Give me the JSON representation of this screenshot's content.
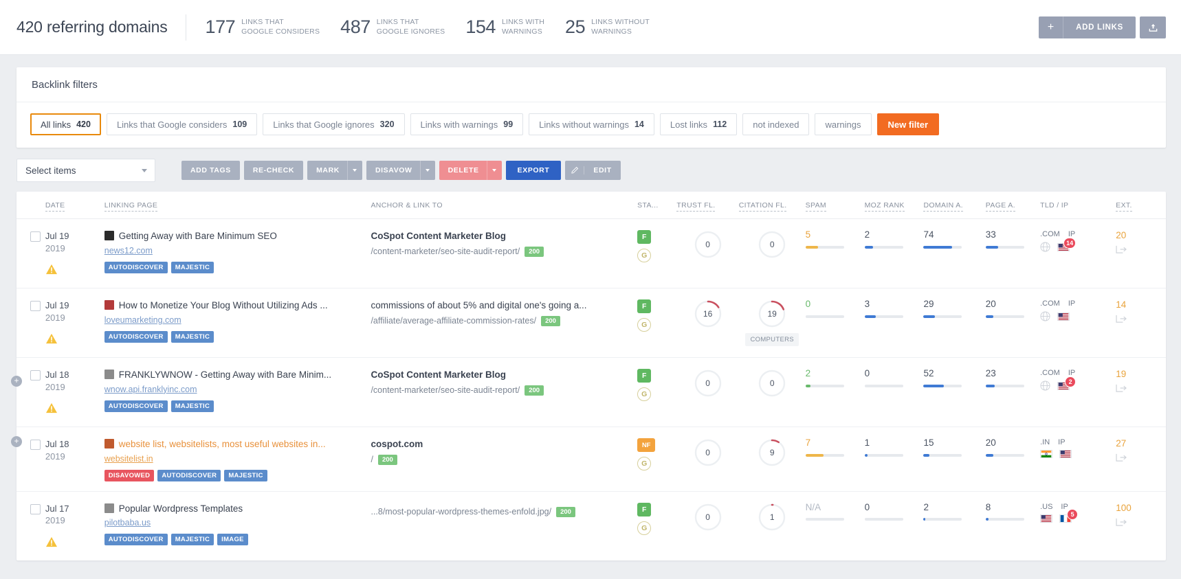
{
  "header": {
    "title": "420 referring domains",
    "stats": [
      {
        "num": "177",
        "label_line1": "LINKS THAT",
        "label_line2": "GOOGLE CONSIDERS"
      },
      {
        "num": "487",
        "label_line1": "LINKS THAT",
        "label_line2": "GOOGLE IGNORES"
      },
      {
        "num": "154",
        "label_line1": "LINKS WITH",
        "label_line2": "WARNINGS"
      },
      {
        "num": "25",
        "label_line1": "LINKS WITHOUT",
        "label_line2": "WARNINGS"
      }
    ],
    "add_links_label": "ADD LINKS",
    "add_plus": "+",
    "upload_icon": "upload-icon"
  },
  "filters": {
    "title": "Backlink filters",
    "chips": [
      {
        "label": "All links",
        "count": "420",
        "state": "active"
      },
      {
        "label": "Links that Google considers",
        "count": "109",
        "state": "normal"
      },
      {
        "label": "Links that Google ignores",
        "count": "320",
        "state": "normal"
      },
      {
        "label": "Links with warnings",
        "count": "99",
        "state": "normal"
      },
      {
        "label": "Links without warnings",
        "count": "14",
        "state": "normal"
      },
      {
        "label": "Lost links",
        "count": "112",
        "state": "normal"
      },
      {
        "label": "not indexed",
        "count": "",
        "state": "normal"
      },
      {
        "label": "warnings",
        "count": "",
        "state": "normal"
      }
    ],
    "new_filter_label": "New filter"
  },
  "toolbar": {
    "select_items": "Select items",
    "add_tags": "ADD TAGS",
    "recheck": "RE-CHECK",
    "mark": "MARK",
    "disavow": "DISAVOW",
    "delete": "DELETE",
    "export": "EXPORT",
    "edit": "EDIT"
  },
  "table": {
    "columns": [
      {
        "key": "chk",
        "label": ""
      },
      {
        "key": "date",
        "label": "DATE",
        "sortable": true
      },
      {
        "key": "link",
        "label": "LINKING PAGE",
        "sortable": true
      },
      {
        "key": "anch",
        "label": "ANCHOR & LINK TO",
        "sortable": false
      },
      {
        "key": "sta",
        "label": "STA...",
        "sortable": false
      },
      {
        "key": "trust",
        "label": "TRUST FL.",
        "sortable": true
      },
      {
        "key": "cit",
        "label": "CITATION FL.",
        "sortable": true
      },
      {
        "key": "spam",
        "label": "SPAM",
        "sortable": true
      },
      {
        "key": "moz",
        "label": "MOZ RANK",
        "sortable": true
      },
      {
        "key": "dom",
        "label": "DOMAIN A.",
        "sortable": true
      },
      {
        "key": "page",
        "label": "PAGE A.",
        "sortable": true
      },
      {
        "key": "tld",
        "label": "TLD / IP",
        "sortable": false
      },
      {
        "key": "ext",
        "label": "EXT.",
        "sortable": true
      }
    ],
    "rows": [
      {
        "date_day": "Jul 19",
        "date_year": "2019",
        "warning": true,
        "favicon_color": "#2b2b2b",
        "link_title": "Getting Away with Bare Minimum SEO",
        "link_url": "news12.com",
        "tags": [
          {
            "text": "AUTODISCOVER",
            "kind": "blue"
          },
          {
            "text": "MAJESTIC",
            "kind": "blue"
          }
        ],
        "anchor_title": "CoSpot Content Marketer Blog",
        "anchor_bold": true,
        "anchor_path": "/content-marketer/seo-site-audit-report/",
        "anchor_code": "200",
        "flag_badge": "F",
        "flag_badge_kind": "green",
        "google_badge": "G",
        "trust": "0",
        "trust_pct": 0,
        "citation": "0",
        "citation_pct": 0,
        "category_tag": "",
        "spam": "5",
        "spam_color": "orange",
        "spam_pct": 33,
        "spam_bar": "#eeb64a",
        "moz": "2",
        "moz_pct": 22,
        "moz_bar": "#3f7ad4",
        "domain": "74",
        "domain_pct": 74,
        "domain_bar": "#3f7ad4",
        "page": "33",
        "page_pct": 33,
        "page_bar": "#3f7ad4",
        "tld_label": ".COM",
        "ip_label": "IP",
        "ip_count": "14",
        "tld_flag": "globe",
        "ip_flag": "us",
        "ext": "20"
      },
      {
        "date_day": "Jul 19",
        "date_year": "2019",
        "warning": true,
        "favicon_color": "#b33a3a",
        "link_title": "How to Monetize Your Blog Without Utilizing Ads ...",
        "link_url": "loveumarketing.com",
        "tags": [
          {
            "text": "AUTODISCOVER",
            "kind": "blue"
          },
          {
            "text": "MAJESTIC",
            "kind": "blue"
          }
        ],
        "anchor_title": "commissions of about 5% and digital one's going a...",
        "anchor_bold": false,
        "anchor_path": "/affiliate/average-affiliate-commission-rates/",
        "anchor_code": "200",
        "flag_badge": "F",
        "flag_badge_kind": "green",
        "google_badge": "G",
        "trust": "16",
        "trust_pct": 16,
        "citation": "19",
        "citation_pct": 19,
        "category_tag": "COMPUTERS",
        "spam": "0",
        "spam_color": "green",
        "spam_pct": 0,
        "spam_bar": "#68b96b",
        "moz": "3",
        "moz_pct": 30,
        "moz_bar": "#3f7ad4",
        "domain": "29",
        "domain_pct": 29,
        "domain_bar": "#3f7ad4",
        "page": "20",
        "page_pct": 20,
        "page_bar": "#3f7ad4",
        "tld_label": ".COM",
        "ip_label": "IP",
        "ip_count": "",
        "tld_flag": "globe",
        "ip_flag": "us",
        "ext": "14"
      },
      {
        "date_day": "Jul 18",
        "date_year": "2019",
        "warning": true,
        "favicon_color": "#8b8b8b",
        "link_title": "FRANKLYWNOW - Getting Away with Bare Minim...",
        "link_url": "wnow.api.franklyinc.com",
        "tags": [
          {
            "text": "AUTODISCOVER",
            "kind": "blue"
          },
          {
            "text": "MAJESTIC",
            "kind": "blue"
          }
        ],
        "anchor_title": "CoSpot Content Marketer Blog",
        "anchor_bold": true,
        "anchor_path": "/content-marketer/seo-site-audit-report/",
        "anchor_code": "200",
        "flag_badge": "F",
        "flag_badge_kind": "green",
        "google_badge": "G",
        "trust": "0",
        "trust_pct": 0,
        "citation": "0",
        "citation_pct": 0,
        "category_tag": "",
        "spam": "2",
        "spam_color": "green",
        "spam_pct": 14,
        "spam_bar": "#68b96b",
        "moz": "0",
        "moz_pct": 0,
        "moz_bar": "#3f7ad4",
        "domain": "52",
        "domain_pct": 52,
        "domain_bar": "#3f7ad4",
        "page": "23",
        "page_pct": 23,
        "page_bar": "#3f7ad4",
        "tld_label": ".COM",
        "ip_label": "IP",
        "ip_count": "2",
        "tld_flag": "globe",
        "ip_flag": "us",
        "ext": "19"
      },
      {
        "date_day": "Jul 18",
        "date_year": "2019",
        "warning": false,
        "favicon_color": "#c05a2e",
        "link_title": "website list, websitelists, most useful websites in...",
        "link_title_orange": true,
        "link_url": "websitelist.in",
        "link_url_orange": true,
        "tags": [
          {
            "text": "DISAVOWED",
            "kind": "red"
          },
          {
            "text": "AUTODISCOVER",
            "kind": "blue"
          },
          {
            "text": "MAJESTIC",
            "kind": "blue"
          }
        ],
        "anchor_title": "cospot.com",
        "anchor_bold": true,
        "anchor_path": "/",
        "anchor_code": "200",
        "flag_badge": "NF",
        "flag_badge_kind": "orange",
        "google_badge": "G",
        "trust": "0",
        "trust_pct": 0,
        "citation": "9",
        "citation_pct": 9,
        "category_tag": "",
        "spam": "7",
        "spam_color": "orange",
        "spam_pct": 47,
        "spam_bar": "#eeb64a",
        "moz": "1",
        "moz_pct": 8,
        "moz_bar": "#3f7ad4",
        "domain": "15",
        "domain_pct": 15,
        "domain_bar": "#3f7ad4",
        "page": "20",
        "page_pct": 20,
        "page_bar": "#3f7ad4",
        "tld_label": ".IN",
        "ip_label": "IP",
        "ip_count": "",
        "tld_flag": "in",
        "ip_flag": "us",
        "ext": "27"
      },
      {
        "date_day": "Jul 17",
        "date_year": "2019",
        "warning": true,
        "favicon_color": "#8b8b8b",
        "link_title": "Popular Wordpress Templates",
        "link_url": "pilotbaba.us",
        "tags": [
          {
            "text": "AUTODISCOVER",
            "kind": "blue"
          },
          {
            "text": "MAJESTIC",
            "kind": "blue"
          },
          {
            "text": "IMAGE",
            "kind": "blue"
          }
        ],
        "anchor_title": "",
        "anchor_bold": false,
        "anchor_path": "...8/most-popular-wordpress-themes-enfold.jpg/",
        "anchor_code": "200",
        "flag_badge": "F",
        "flag_badge_kind": "green",
        "google_badge": "G",
        "trust": "0",
        "trust_pct": 0,
        "citation": "1",
        "citation_pct": 1,
        "category_tag": "",
        "spam": "N/A",
        "spam_color": "na",
        "spam_pct": 0,
        "spam_bar": "#e6e9ed",
        "moz": "0",
        "moz_pct": 0,
        "moz_bar": "#3f7ad4",
        "domain": "2",
        "domain_pct": 4,
        "domain_bar": "#3f7ad4",
        "page": "8",
        "page_pct": 8,
        "page_bar": "#3f7ad4",
        "tld_label": ".US",
        "ip_label": "IP",
        "ip_count": "5",
        "tld_flag": "us",
        "ip_flag": "fr",
        "ext": "100"
      }
    ]
  }
}
